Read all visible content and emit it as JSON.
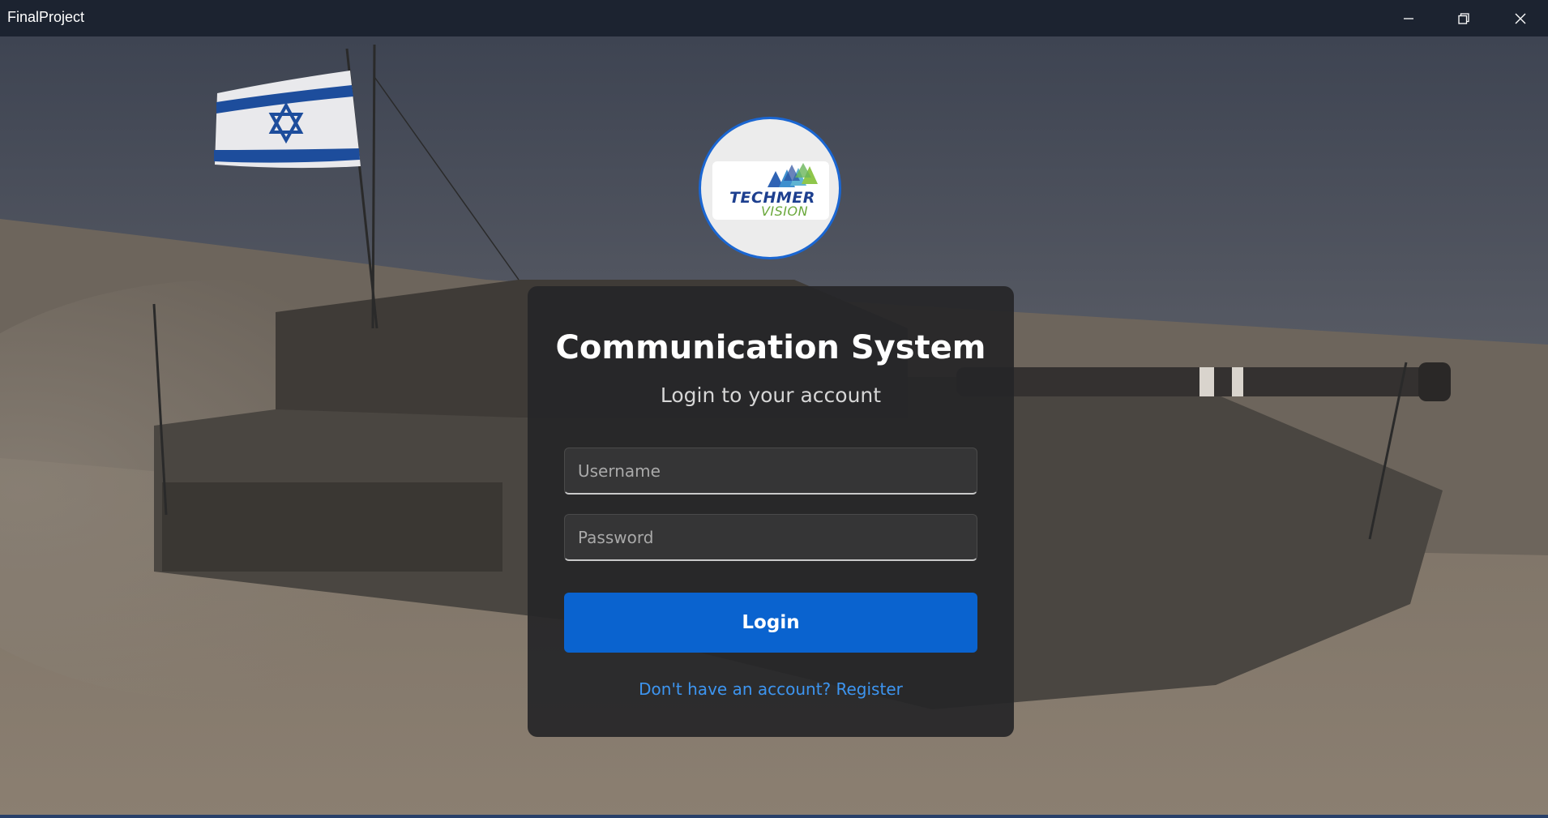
{
  "window": {
    "title": "FinalProject",
    "controls": {
      "minimize_icon": "minimize-icon",
      "maximize_icon": "restore-icon",
      "close_icon": "close-icon"
    }
  },
  "background": {
    "image": "tank-desert-photo"
  },
  "logo": {
    "word1": "TECHMER",
    "word2": "VISION",
    "colors": {
      "primary": "#1d3f8f",
      "secondary": "#6aa83b"
    }
  },
  "login": {
    "title": "Communication System",
    "subtitle": "Login to your account",
    "username_placeholder": "Username",
    "username_value": "",
    "password_placeholder": "Password",
    "password_value": "",
    "login_label": "Login",
    "register_label": "Don't have an account? Register"
  },
  "colors": {
    "accent": "#0a63cf",
    "link": "#3d95f0",
    "card_bg": "#262628",
    "titlebar_bg": "#1c2330"
  }
}
